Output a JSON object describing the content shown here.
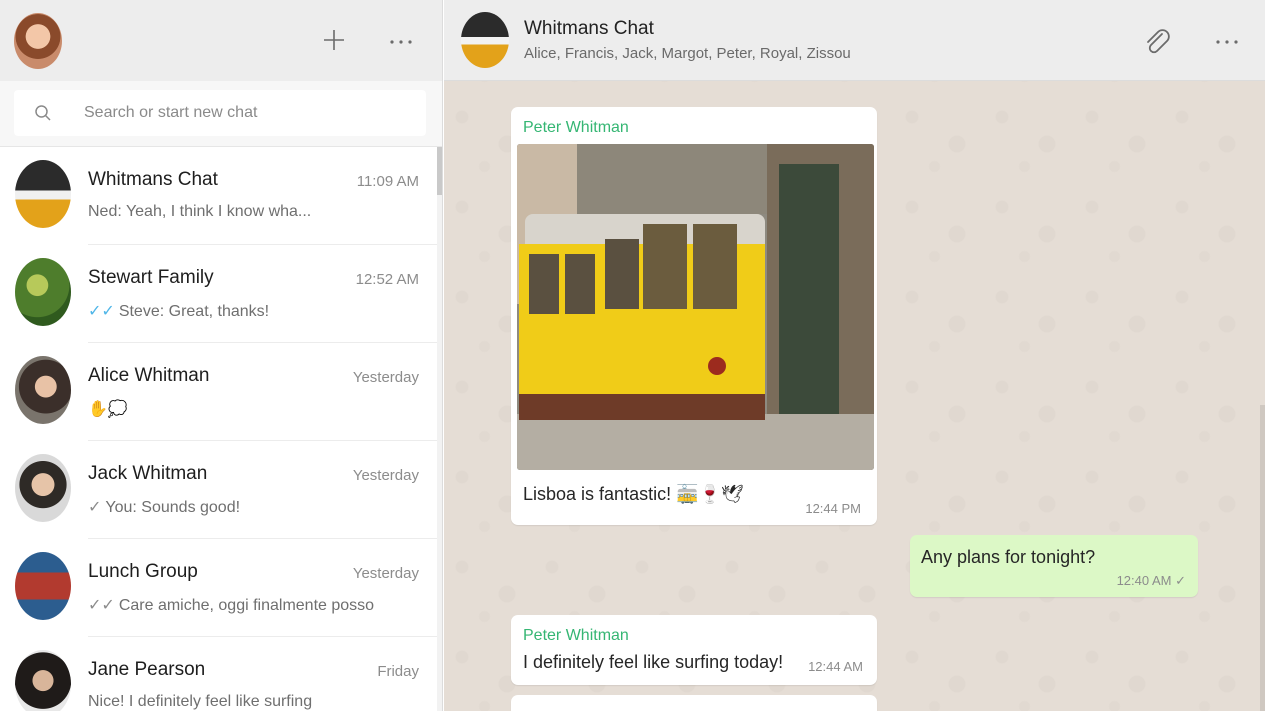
{
  "left": {
    "search_placeholder": "Search or start new chat",
    "chats": [
      {
        "name": "Whitmans Chat",
        "time": "11:09 AM",
        "preview": "Ned: Yeah, I think I know wha...",
        "tick": ""
      },
      {
        "name": "Stewart Family",
        "time": "12:52 AM",
        "preview": "Steve: Great, thanks!",
        "tick": "✓✓"
      },
      {
        "name": "Alice Whitman",
        "time": "Yesterday",
        "preview": "✋💭",
        "tick": ""
      },
      {
        "name": "Jack Whitman",
        "time": "Yesterday",
        "preview": "You: Sounds good!",
        "tick": "✓"
      },
      {
        "name": "Lunch Group",
        "time": "Yesterday",
        "preview": "Care amiche, oggi finalmente posso",
        "tick": "✓✓"
      },
      {
        "name": "Jane Pearson",
        "time": "Friday",
        "preview": "Nice! I definitely feel like surfing",
        "tick": ""
      }
    ]
  },
  "conversation": {
    "title": "Whitmans Chat",
    "members": "Alice, Francis, Jack, Margot, Peter, Royal, Zissou",
    "messages": [
      {
        "sender": "Peter Whitman",
        "text": "Lisboa is fantastic! 🚋🍷🕊",
        "time": "12:44 PM"
      },
      {
        "text": "Any plans for tonight?",
        "time": "12:40 AM ✓"
      },
      {
        "sender": "Peter Whitman",
        "text": "I definitely feel like surfing today!",
        "time": "12:44 AM"
      }
    ]
  },
  "colors": {
    "accent_green": "#35b673",
    "outgoing_bubble": "#dcf8c6",
    "chat_bg": "#e5ddd5",
    "read_tick": "#4fb6e8"
  },
  "icons": {
    "new_chat": "plus-icon",
    "menu": "more-icon",
    "search": "search-icon",
    "attach": "paperclip-icon"
  }
}
